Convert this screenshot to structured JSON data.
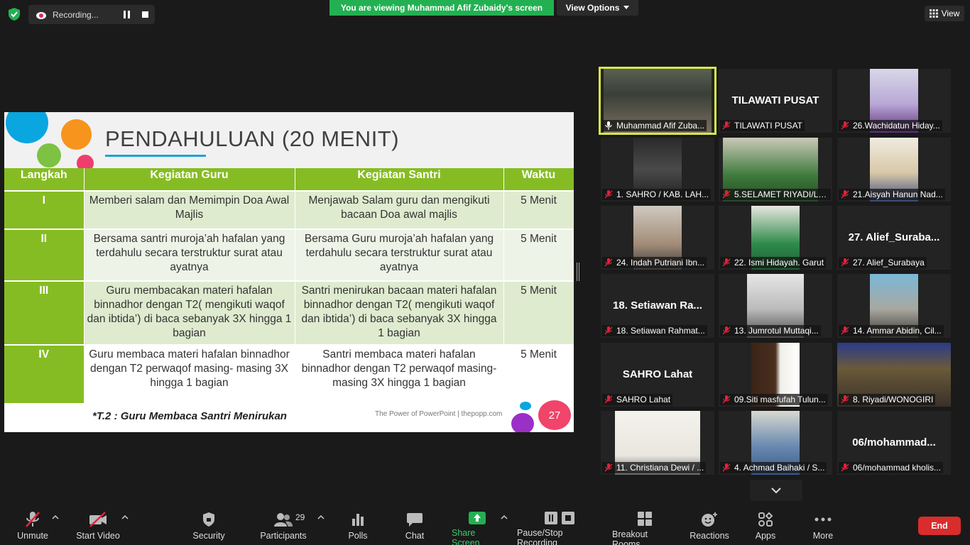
{
  "topbar": {
    "recording_label": "Recording...",
    "banner": "You are viewing Muhammad Afif Zubaidy's screen",
    "view_options": "View Options",
    "view": "View"
  },
  "slide": {
    "title": "PENDAHULUAN (20 MENIT)",
    "headers": [
      "Langkah",
      "Kegiatan Guru",
      "Kegiatan Santri",
      "Waktu"
    ],
    "rows": [
      {
        "step": "I",
        "guru": "Memberi salam dan Memimpin Doa Awal Majlis",
        "santri": "Menjawab Salam guru dan mengikuti bacaan Doa awal majlis",
        "waktu": "5 Menit"
      },
      {
        "step": "II",
        "guru": "Bersama santri muroja’ah hafalan yang terdahulu secara terstruktur surat atau ayatnya",
        "santri": "Bersama Guru muroja’ah hafalan yang terdahulu secara terstruktur surat atau ayatnya",
        "waktu": "5 Menit"
      },
      {
        "step": "III",
        "guru": "Guru membacakan materi hafalan binnadhor  dengan T2( mengikuti waqof dan ibtida’) di baca sebanyak 3X hingga 1 bagian",
        "santri": "Santri menirukan bacaan materi hafalan binnadhor  dengan T2( mengikuti waqof dan ibtida’) di baca sebanyak 3X hingga 1 bagian",
        "waktu": "5 Menit"
      },
      {
        "step": "IV",
        "guru": "Guru membaca materi hafalan binnadhor dengan T2 perwaqof masing- masing 3X hingga 1 bagian",
        "santri": "Santri membaca materi hafalan binnadhor dengan T2 perwaqof masing- masing 3X hingga 1 bagian",
        "waktu": "5 Menit"
      }
    ],
    "footnote": "*T.2 : Guru Membaca Santri Menirukan",
    "source": "The Power of PowerPoint | thepopp.com",
    "page_number": "27"
  },
  "participants": [
    {
      "label": "Muhammad Afif Zuba...",
      "big": "",
      "video": true,
      "active": true
    },
    {
      "label": "TILAWATI PUSAT",
      "big": "TILAWATI PUSAT",
      "video": false
    },
    {
      "label": "26.Wachidatun Hiday...",
      "big": "",
      "video": true
    },
    {
      "label": "1.  SAHRO / KAB. LAH...",
      "big": "",
      "video": true
    },
    {
      "label": "5.SELAMET RIYADI/LO...",
      "big": "",
      "video": true
    },
    {
      "label": "21.Aisyah Hanun Nad...",
      "big": "",
      "video": true
    },
    {
      "label": "24. Indah Putriani Ibn...",
      "big": "",
      "video": true
    },
    {
      "label": "22. Ismi Hidayah. Garut",
      "big": "",
      "video": true
    },
    {
      "label": "27. Alief_Surabaya",
      "big": "27.  Alief_Suraba...",
      "video": false
    },
    {
      "label": "18. Setiawan Rahmat...",
      "big": "18.  Setiawan  Ra...",
      "video": false
    },
    {
      "label": "13. Jumrotul Muttaqi...",
      "big": "",
      "video": true
    },
    {
      "label": "14. Ammar Abidin, Cil...",
      "big": "",
      "video": true
    },
    {
      "label": "SAHRO Lahat",
      "big": "SAHRO Lahat",
      "video": false
    },
    {
      "label": "09.Siti masfufah Tulun...",
      "big": "",
      "video": true
    },
    {
      "label": "8. Riyadi/WONOGIRI",
      "big": "",
      "video": true
    },
    {
      "label": "11. Christiana Dewi / ...",
      "big": "",
      "video": true
    },
    {
      "label": "4. Achmad Baihaki / S...",
      "big": "",
      "video": true
    },
    {
      "label": "06/mohammad kholis...",
      "big": "06/mohammad...",
      "video": false
    }
  ],
  "toolbar": {
    "unmute": "Unmute",
    "start_video": "Start Video",
    "security": "Security",
    "participants": "Participants",
    "participants_count": "29",
    "polls": "Polls",
    "chat": "Chat",
    "share_screen": "Share Screen",
    "pause_stop": "Pause/Stop Recording",
    "breakout": "Breakout Rooms",
    "reactions": "Reactions",
    "apps": "Apps",
    "more": "More",
    "end": "End"
  },
  "colors": {
    "banner_green": "#23b052",
    "table_green": "#86bc23",
    "end_red": "#d92c2c",
    "active_speaker": "#d8e84a"
  }
}
